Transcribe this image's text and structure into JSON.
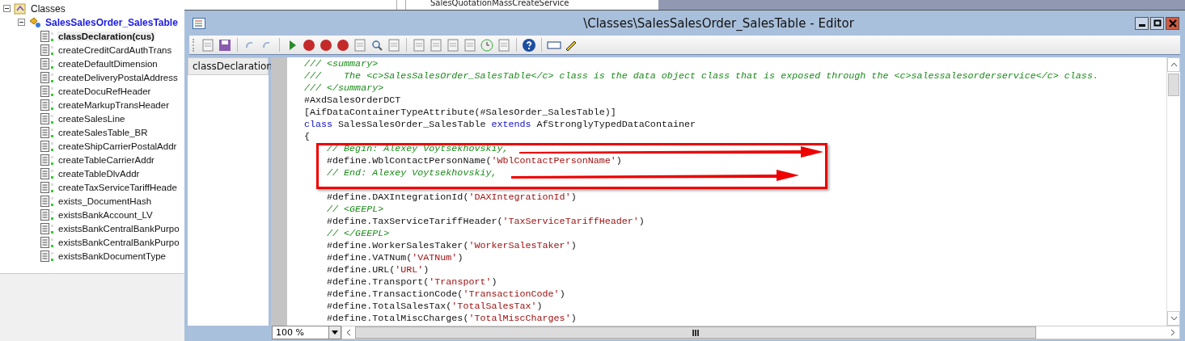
{
  "background": {
    "list_item": "SalesQuotationMassCreateService"
  },
  "tree": {
    "root": {
      "label": "Classes",
      "expanded": true,
      "children": [
        {
          "label": "SalesSalesOrder_SalesTable",
          "expanded": true,
          "children": [
            {
              "label": "classDeclaration(cus)",
              "selected": true
            },
            {
              "label": "createCreditCardAuthTrans",
              "selected": false
            },
            {
              "label": "createDefaultDimension",
              "selected": false
            },
            {
              "label": "createDeliveryPostalAddress",
              "selected": false
            },
            {
              "label": "createDocuRefHeader",
              "selected": false
            },
            {
              "label": "createMarkupTransHeader",
              "selected": false
            },
            {
              "label": "createSalesLine",
              "selected": false
            },
            {
              "label": "createSalesTable_BR",
              "selected": false
            },
            {
              "label": "createShipCarrierPostalAddr",
              "selected": false
            },
            {
              "label": "createTableCarrierAddr",
              "selected": false
            },
            {
              "label": "createTableDlvAddr",
              "selected": false
            },
            {
              "label": "createTaxServiceTariffHeade",
              "selected": false
            },
            {
              "label": "exists_DocumentHash",
              "selected": false
            },
            {
              "label": "existsBankAccount_LV",
              "selected": false
            },
            {
              "label": "existsBankCentralBankPurpo",
              "selected": false
            },
            {
              "label": "existsBankCentralBankPurpo",
              "selected": false
            },
            {
              "label": "existsBankDocumentType",
              "selected": false
            }
          ]
        }
      ]
    }
  },
  "editor": {
    "title": "\\Classes\\SalesSalesOrder_SalesTable - Editor",
    "methods": [
      {
        "label": "classDeclaration",
        "selected": true
      }
    ],
    "code_lines": [
      {
        "kind": "code",
        "segments": [
          {
            "kind": "comment",
            "text": "/// <summary>"
          }
        ]
      },
      {
        "kind": "code",
        "segments": [
          {
            "kind": "comment",
            "text": "///    The <c>SalesSalesOrder_SalesTable</c> class is the data object class that is exposed through the <c>salessalesorderservice</c> class."
          }
        ]
      },
      {
        "kind": "code",
        "segments": [
          {
            "kind": "comment",
            "text": "/// </summary>"
          }
        ]
      },
      {
        "kind": "code",
        "segments": [
          {
            "kind": "plain",
            "text": "#AxdSalesOrderDCT"
          }
        ]
      },
      {
        "kind": "code",
        "segments": [
          {
            "kind": "plain",
            "text": "[AifDataContainerTypeAttribute(#SalesOrder_SalesTable)]"
          }
        ]
      },
      {
        "kind": "code",
        "segments": [
          {
            "kind": "keyword",
            "text": "class"
          },
          {
            "kind": "plain",
            "text": " SalesSalesOrder_SalesTable "
          },
          {
            "kind": "keyword",
            "text": "extends"
          },
          {
            "kind": "plain",
            "text": " AfStronglyTypedDataContainer"
          }
        ]
      },
      {
        "kind": "code",
        "segments": [
          {
            "kind": "plain",
            "text": "{"
          }
        ]
      },
      {
        "kind": "code",
        "segments": [
          {
            "kind": "comment",
            "text": "    // Begin: Alexey Voytsekhovskiy,"
          }
        ]
      },
      {
        "kind": "code",
        "segments": [
          {
            "kind": "plain",
            "text": "    #define.WblContactPersonName("
          },
          {
            "kind": "string",
            "text": "'WblContactPersonName'"
          },
          {
            "kind": "plain",
            "text": ")"
          }
        ]
      },
      {
        "kind": "code",
        "segments": [
          {
            "kind": "comment",
            "text": "    // End: Alexey Voytsekhovskiy,"
          }
        ]
      },
      {
        "kind": "blank"
      },
      {
        "kind": "code",
        "segments": [
          {
            "kind": "plain",
            "text": "    #define.DAXIntegrationId("
          },
          {
            "kind": "string",
            "text": "'DAXIntegrationId'"
          },
          {
            "kind": "plain",
            "text": ")"
          }
        ]
      },
      {
        "kind": "code",
        "segments": [
          {
            "kind": "comment",
            "text": "    // <GEEPL>"
          }
        ]
      },
      {
        "kind": "code",
        "segments": [
          {
            "kind": "plain",
            "text": "    #define.TaxServiceTariffHeader("
          },
          {
            "kind": "string",
            "text": "'TaxServiceTariffHeader'"
          },
          {
            "kind": "plain",
            "text": ")"
          }
        ]
      },
      {
        "kind": "code",
        "segments": [
          {
            "kind": "comment",
            "text": "    // </GEEPL>"
          }
        ]
      },
      {
        "kind": "code",
        "segments": [
          {
            "kind": "plain",
            "text": "    #define.WorkerSalesTaker("
          },
          {
            "kind": "string",
            "text": "'WorkerSalesTaker'"
          },
          {
            "kind": "plain",
            "text": ")"
          }
        ]
      },
      {
        "kind": "code",
        "segments": [
          {
            "kind": "plain",
            "text": "    #define.VATNum("
          },
          {
            "kind": "string",
            "text": "'VATNum'"
          },
          {
            "kind": "plain",
            "text": ")"
          }
        ]
      },
      {
        "kind": "code",
        "segments": [
          {
            "kind": "plain",
            "text": "    #define.URL("
          },
          {
            "kind": "string",
            "text": "'URL'"
          },
          {
            "kind": "plain",
            "text": ")"
          }
        ]
      },
      {
        "kind": "code",
        "segments": [
          {
            "kind": "plain",
            "text": "    #define.Transport("
          },
          {
            "kind": "string",
            "text": "'Transport'"
          },
          {
            "kind": "plain",
            "text": ")"
          }
        ]
      },
      {
        "kind": "code",
        "segments": [
          {
            "kind": "plain",
            "text": "    #define.TransactionCode("
          },
          {
            "kind": "string",
            "text": "'TransactionCode'"
          },
          {
            "kind": "plain",
            "text": ")"
          }
        ]
      },
      {
        "kind": "code",
        "segments": [
          {
            "kind": "plain",
            "text": "    #define.TotalSalesTax("
          },
          {
            "kind": "string",
            "text": "'TotalSalesTax'"
          },
          {
            "kind": "plain",
            "text": ")"
          }
        ]
      },
      {
        "kind": "code",
        "segments": [
          {
            "kind": "plain",
            "text": "    #define.TotalMiscCharges("
          },
          {
            "kind": "string",
            "text": "'TotalMiscCharges'"
          },
          {
            "kind": "plain",
            "text": ")"
          }
        ]
      }
    ],
    "zoom": "100 %"
  }
}
